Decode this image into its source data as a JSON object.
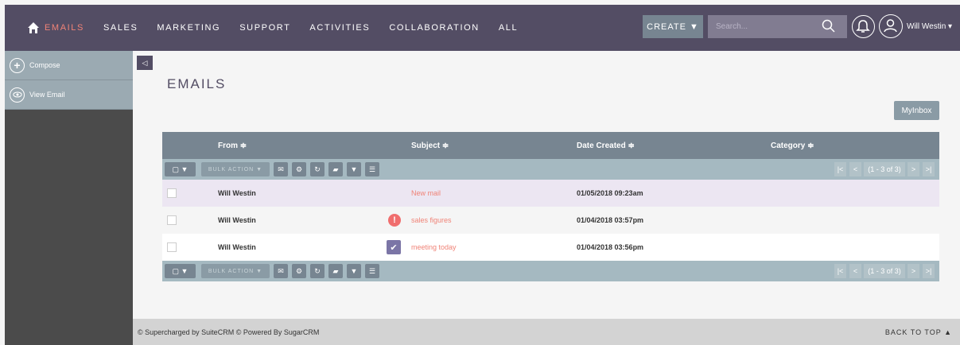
{
  "nav": {
    "items": [
      "EMAILS",
      "SALES",
      "MARKETING",
      "SUPPORT",
      "ACTIVITIES",
      "COLLABORATION",
      "ALL"
    ],
    "create_label": "CREATE ▼",
    "search_placeholder": "Search...",
    "user_name": "Will Westin ▾"
  },
  "sidebar": {
    "items": [
      {
        "label": "Compose"
      },
      {
        "label": "View Email"
      }
    ]
  },
  "page": {
    "title": "EMAILS",
    "myinbox_label": "MyInbox"
  },
  "table": {
    "columns": [
      "From ≑",
      "Subject ≑",
      "Date Created ≑",
      "Category ≑"
    ],
    "bulk_action": "BULK ACTION ▼",
    "pagination": "(1 - 3 of 3)",
    "rows": [
      {
        "from": "Will Westin",
        "subject": "New mail",
        "date": "01/05/2018 09:23am"
      },
      {
        "from": "Will Westin",
        "subject": "sales figures",
        "date": "01/04/2018 03:57pm"
      },
      {
        "from": "Will Westin",
        "subject": "meeting today",
        "date": "01/04/2018 03:56pm"
      }
    ]
  },
  "footer": {
    "left": "© Supercharged by SuiteCRM   © Powered By SugarCRM",
    "right": "BACK TO TOP ▲"
  },
  "colors": {
    "nav_bg": "#534d64",
    "accent": "#f08377",
    "sidebar_item": "#9baab2"
  }
}
